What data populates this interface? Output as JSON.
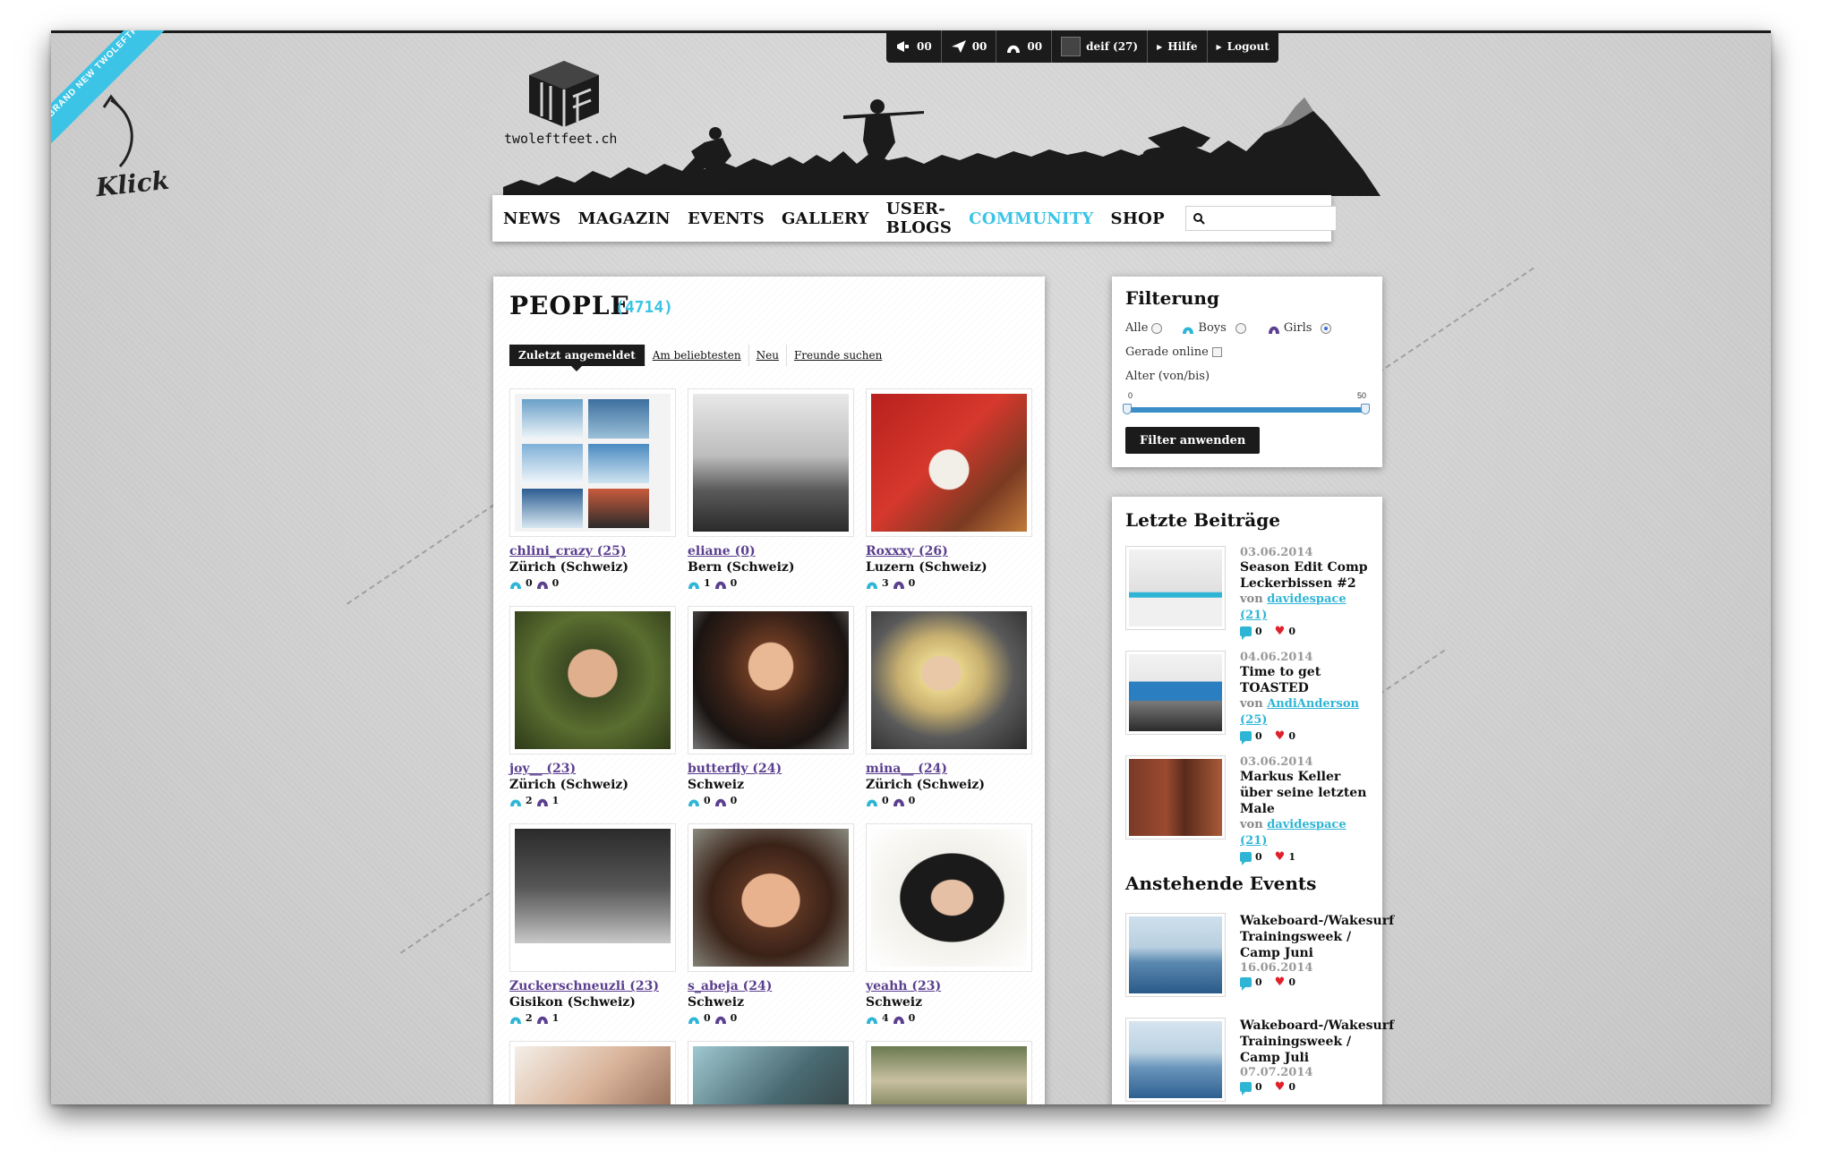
{
  "ribbon": {
    "text": "BRAND NEW TWOLEFTFEET"
  },
  "klick": {
    "label": "Klick"
  },
  "topbar": {
    "items": [
      {
        "icon": "megaphone-icon",
        "value": "00"
      },
      {
        "icon": "paper-plane-icon",
        "value": "00"
      },
      {
        "icon": "friends-icon",
        "value": "00"
      },
      {
        "icon": "avatar",
        "label": "deif (27)"
      },
      {
        "label": "Hilfe"
      },
      {
        "label": "Logout"
      }
    ]
  },
  "site": {
    "logo_text": "twoleftfeet.ch"
  },
  "nav": {
    "links": [
      "NEWS",
      "MAGAZIN",
      "EVENTS",
      "GALLERY",
      "USER-BLOGS",
      "COMMUNITY",
      "SHOP"
    ],
    "active": "COMMUNITY",
    "search_placeholder": "",
    "accent": "#3cc4e6"
  },
  "people": {
    "title": "PEOPLE",
    "count": "(4714)",
    "tabs": [
      "Zuletzt angemeldet",
      "Am beliebtesten",
      "Neu",
      "Freunde suchen"
    ],
    "active_tab": "Zuletzt angemeldet",
    "users": [
      {
        "name": "chlini_crazy (25)",
        "location": "Zürich (Schweiz)",
        "boys": "0",
        "girls": "0",
        "photo": "collage"
      },
      {
        "name": "eliane (0)",
        "location": "Bern (Schweiz)",
        "boys": "1",
        "girls": "0",
        "photo": "bw-bridge"
      },
      {
        "name": "Roxxxy (26)",
        "location": "Luzern (Schweiz)",
        "boys": "3",
        "girls": "0",
        "photo": "red-sofa"
      },
      {
        "name": "joy__ (23)",
        "location": "Zürich (Schweiz)",
        "boys": "2",
        "girls": "1",
        "photo": "green-garden"
      },
      {
        "name": "butterfly (24)",
        "location": "Schweiz",
        "boys": "0",
        "girls": "0",
        "photo": "dark-portrait"
      },
      {
        "name": "mina__ (24)",
        "location": "Zürich (Schweiz)",
        "boys": "0",
        "girls": "0",
        "photo": "sunglasses"
      },
      {
        "name": "Zuckerschneuzli (23)",
        "location": "Gisikon (Schweiz)",
        "boys": "2",
        "girls": "1",
        "photo": "bw-crowd"
      },
      {
        "name": "s_abeja (24)",
        "location": "Schweiz",
        "boys": "0",
        "girls": "0",
        "photo": "selfie"
      },
      {
        "name": "yeahh (23)",
        "location": "Schweiz",
        "boys": "4",
        "girls": "0",
        "photo": "hat-portrait"
      },
      {
        "name": "",
        "location": "",
        "boys": "",
        "girls": "",
        "photo": "partial-1"
      },
      {
        "name": "",
        "location": "",
        "boys": "",
        "girls": "",
        "photo": "partial-2"
      },
      {
        "name": "",
        "location": "",
        "boys": "",
        "girls": "",
        "photo": "partial-3"
      }
    ]
  },
  "filter": {
    "title": "Filterung",
    "gender_options": [
      "Alle",
      "Boys",
      "Girls"
    ],
    "gender_selected": "Girls",
    "online_label": "Gerade online",
    "age_label": "Alter (von/bis)",
    "age_min": "0",
    "age_max": "50",
    "button": "Filter anwenden"
  },
  "posts": {
    "title": "Letzte Beiträge",
    "items": [
      {
        "date": "03.06.2014",
        "title": "Season Edit Comp Leckerbissen #2",
        "by": "von",
        "author": "davidespace (21)",
        "comments": "0",
        "likes": "0"
      },
      {
        "date": "04.06.2014",
        "title": "Time to get TOASTED",
        "by": "von",
        "author": "AndiAnderson (25)",
        "comments": "0",
        "likes": "0"
      },
      {
        "date": "03.06.2014",
        "title": "Markus Keller über seine letzten Male",
        "by": "von",
        "author": "davidespace (21)",
        "comments": "0",
        "likes": "1"
      }
    ]
  },
  "events": {
    "title": "Anstehende Events",
    "items": [
      {
        "title": "Wakeboard-/Wakesurf Trainingsweek / Camp Juni",
        "date": "16.06.2014",
        "comments": "0",
        "likes": "0"
      },
      {
        "title": "Wakeboard-/Wakesurf Trainingsweek / Camp Juli",
        "date": "07.07.2014",
        "comments": "0",
        "likes": "0"
      }
    ]
  }
}
